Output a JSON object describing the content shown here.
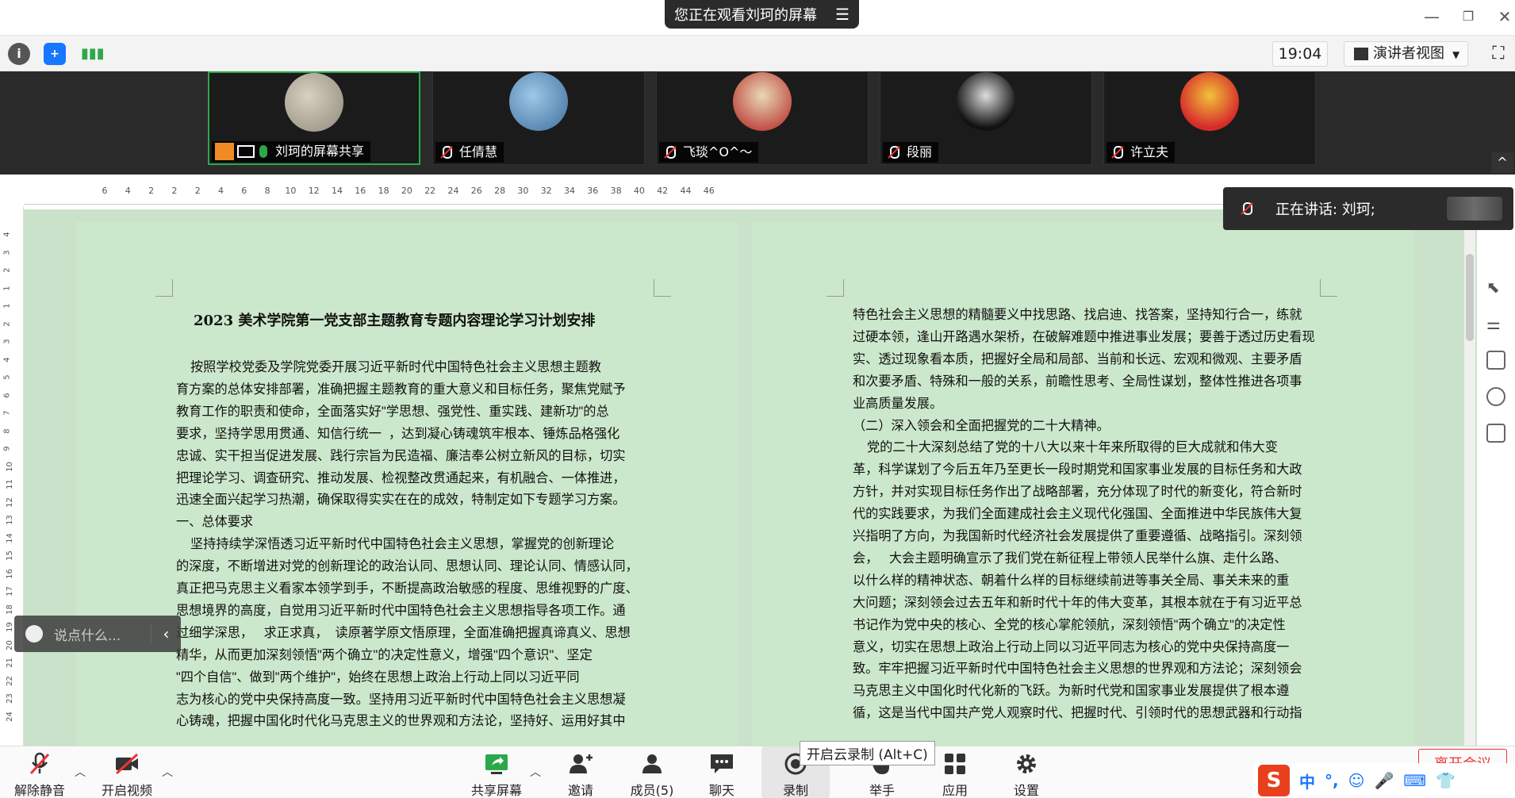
{
  "banner": {
    "text": "您正在观看刘珂的屏幕"
  },
  "toolbar": {
    "clock": "19:04",
    "view_mode": "演讲者视图"
  },
  "participants": [
    {
      "name": "刘珂的屏幕共享",
      "active": true
    },
    {
      "name": "任倩慧"
    },
    {
      "name": "飞琰^O^～"
    },
    {
      "name": "段丽"
    },
    {
      "name": "许立夫"
    }
  ],
  "speaking": {
    "label": "正在讲话: 刘珂;"
  },
  "chat": {
    "placeholder": "说点什么..."
  },
  "document": {
    "title": "2023 美术学院第一党支部主题教育专题内容理论学习计划安排",
    "left_lines": [
      "    按照学校党委及学院党委开展习近平新时代中国特色社会主义思想主题教",
      "育方案的总体安排部署，准确把握主题教育的重大意义和目标任务，聚焦党赋予",
      "教育工作的职责和使命，全面落实好\"学思想、强党性、重实践、建新功\"的总",
      "要求，坚持学思用贯通、知信行统一  ，达到凝心铸魂筑牢根本、锤炼品格强化",
      "忠诚、实干担当促进发展、践行宗旨为民造福、廉洁奉公树立新风的目标，切实",
      "把理论学习、调查研究、推动发展、检视整改贯通起来，有机融合、一体推进，",
      "迅速全面兴起学习热潮，确保取得实实在在的成效，特制定如下专题学习方案。",
      "一、总体要求",
      "    坚持持续学深悟透习近平新时代中国特色社会主义思想，掌握党的创新理论",
      "的深度，不断增进对党的创新理论的政治认同、思想认同、理论认同、情感认同，",
      "真正把马克思主义看家本领学到手，不断提高政治敏感的程度、思维视野的广度、",
      "思想境界的高度，自觉用习近平新时代中国特色社会主义思想指导各项工作。通",
      "过细学深思，   求正求真，  读原著学原文悟原理，全面准确把握真谛真义、思想",
      "精华，从而更加深刻领悟\"两个确立\"的决定性意义，增强\"四个意识\"、坚定",
      "\"四个自信\"、做到\"两个维护\"，始终在思想上政治上行动上同以习近平同",
      "志为核心的党中央保持高度一致。坚持用习近平新时代中国特色社会主义思想凝",
      "心铸魂，把握中国化时代化马克思主义的世界观和方法论，坚持好、运用好其中"
    ],
    "right_lines": [
      "特色社会主义思想的精髓要义中找思路、找启迪、找答案，坚持知行合一，练就",
      "过硬本领，逢山开路遇水架桥，在破解难题中推进事业发展；要善于透过历史看现",
      "实、透过现象看本质，把握好全局和局部、当前和长远、宏观和微观、主要矛盾",
      "和次要矛盾、特殊和一般的关系，前瞻性思考、全局性谋划，整体性推进各项事",
      "业高质量发展。",
      "（二）深入领会和全面把握党的二十大精神。",
      "    党的二十大深刻总结了党的十八大以来十年来所取得的巨大成就和伟大变",
      "革，科学谋划了今后五年乃至更长一段时期党和国家事业发展的目标任务和大政",
      "方针，并对实现目标任务作出了战略部署，充分体现了时代的新变化，符合新时",
      "代的实践要求，为我们全面建成社会主义现代化强国、全面推进中华民族伟大复",
      "兴指明了方向，为我国新时代经济社会发展提供了重要遵循、战略指引。深刻领",
      "会，   大会主题明确宣示了我们党在新征程上带领人民举什么旗、走什么路、",
      "以什么样的精神状态、朝着什么样的目标继续前进等事关全局、事关未来的重",
      "大问题；深刻领会过去五年和新时代十年的伟大变革，其根本就在于有习近平总",
      "书记作为党中央的核心、全党的核心掌舵领航，深刻领悟\"两个确立\"的决定性",
      "意义，切实在思想上政治上行动上同以习近平同志为核心的党中央保持高度一",
      "致。牢牢把握习近平新时代中国特色社会主义思想的世界观和方法论；深刻领会",
      "马克思主义中国化时代化新的飞跃。为新时代党和国家事业发展提供了根本遵",
      "循，这是当代中国共产党人观察时代、把握时代、引领时代的思想武器和行动指"
    ]
  },
  "ruler": {
    "h_ticks": [
      "6",
      "4",
      "2",
      "2",
      "2",
      "4",
      "6",
      "8",
      "10",
      "12",
      "14",
      "16",
      "18",
      "20",
      "22",
      "24",
      "26",
      "28",
      "30",
      "32",
      "34",
      "36",
      "38",
      "40",
      "42",
      "44",
      "46"
    ],
    "v_ticks": [
      "4",
      "3",
      "2",
      "1",
      "1",
      "2",
      "3",
      "4",
      "5",
      "6",
      "7",
      "8",
      "9",
      "10",
      "11",
      "12",
      "13",
      "14",
      "15",
      "16",
      "17",
      "18",
      "19",
      "20",
      "21",
      "22",
      "23",
      "24"
    ]
  },
  "bottom": {
    "mute": "解除静音",
    "video": "开启视频",
    "share": "共享屏幕",
    "invite": "邀请",
    "members": "成员(5)",
    "chat": "聊天",
    "record": "录制",
    "record_tip": "开启云录制 (Alt+C)",
    "raise": "举手",
    "apps": "应用",
    "settings": "设置",
    "leave": "离开会议"
  },
  "colors": {
    "accent_green": "#2ba84a",
    "record_red": "#e33",
    "doc_bg": "#cce8cc",
    "ime_blue": "#1677ff"
  },
  "ime": {
    "logo": "S",
    "lang": "中",
    "punct": "°,"
  }
}
